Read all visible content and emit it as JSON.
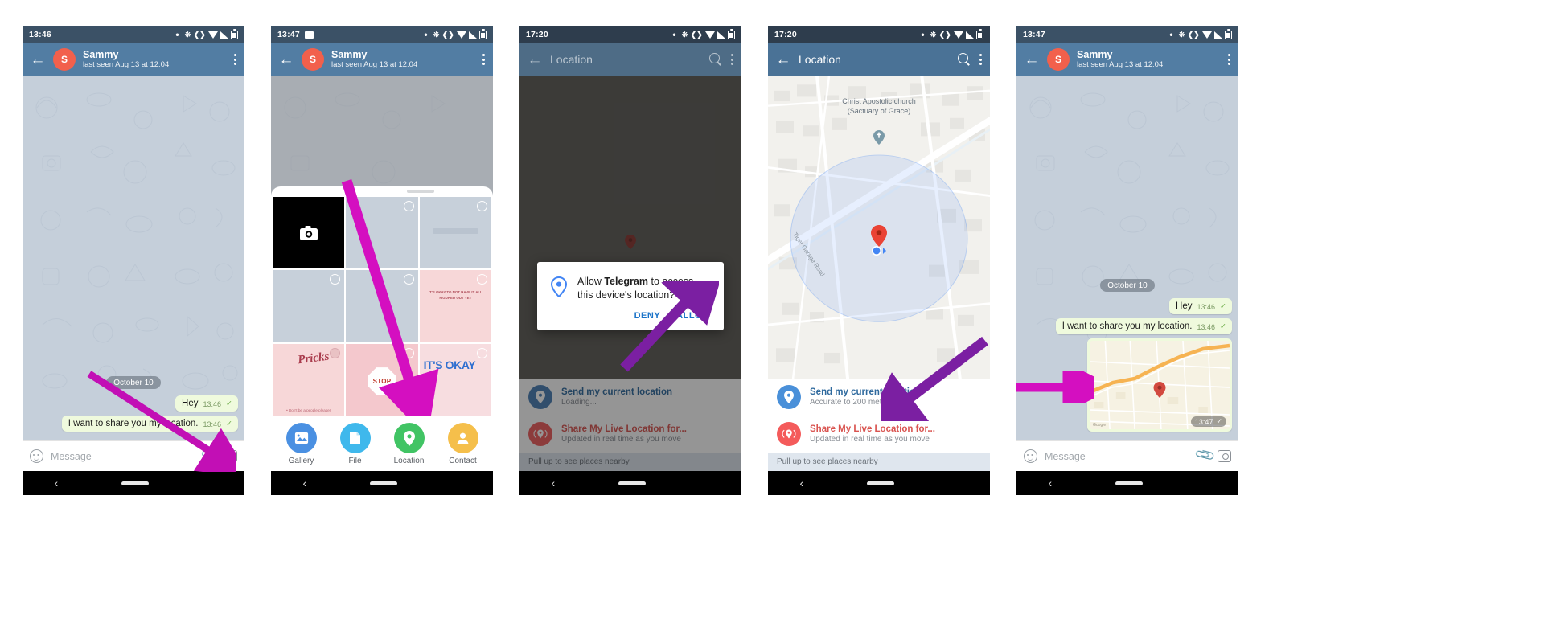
{
  "panels": [
    {
      "id": "chat-before",
      "status": {
        "time": "13:46"
      },
      "appbar": {
        "name": "Sammy",
        "subtitle": "last seen Aug 13 at 12:04",
        "avatar_initial": "S"
      },
      "chat": {
        "date_chip": "October 10",
        "messages": [
          {
            "text": "Hey",
            "time": "13:46",
            "status": "✓"
          },
          {
            "text": "I want to share you my location.",
            "time": "13:46",
            "status": "✓"
          }
        ]
      },
      "composer": {
        "placeholder": "Message"
      }
    },
    {
      "id": "attach-sheet",
      "status": {
        "time": "13:47"
      },
      "appbar": {
        "name": "Sammy",
        "subtitle": "last seen Aug 13 at 12:04",
        "avatar_initial": "S"
      },
      "attach_options": [
        {
          "label": "Gallery",
          "color": "#4a90e2",
          "icon": "image-icon"
        },
        {
          "label": "File",
          "color": "#3fb8ec",
          "icon": "file-icon"
        },
        {
          "label": "Location",
          "color": "#41c464",
          "icon": "pin-icon"
        },
        {
          "label": "Contact",
          "color": "#f5bf4b",
          "icon": "person-icon"
        }
      ],
      "gallery_tiles": [
        {
          "kind": "camera",
          "label": ""
        },
        {
          "kind": "photo",
          "label": ""
        },
        {
          "kind": "photo",
          "label": ""
        },
        {
          "kind": "photo",
          "label": ""
        },
        {
          "kind": "photo",
          "label": ""
        },
        {
          "kind": "note",
          "label": "IT'S OKAY TO NOT HAVE IT ALL FIGURED OUT YET"
        },
        {
          "kind": "pricks",
          "label": "Pricks"
        },
        {
          "kind": "stop",
          "label": "STOP"
        },
        {
          "kind": "okay",
          "label": "IT'S OKAY"
        }
      ]
    },
    {
      "id": "permission-dialog",
      "status": {
        "time": "17:20"
      },
      "appbar": {
        "title": "Location"
      },
      "dialog": {
        "text_before": "Allow ",
        "app_name": "Telegram",
        "text_after": " to access this device's location?",
        "deny_label": "DENY",
        "allow_label": "ALLOW"
      },
      "location_list": [
        {
          "title": "Send my current location",
          "subtitle": "Loading...",
          "color": "#4a7fb5",
          "icon": "pin-icon"
        },
        {
          "title": "Share My Live Location for...",
          "subtitle": "Updated in real time as you move",
          "color": "#ef5b5b",
          "icon": "live-pin-icon"
        }
      ],
      "footer": "Pull up to see places nearby"
    },
    {
      "id": "location-picker",
      "status": {
        "time": "17:20"
      },
      "appbar": {
        "title": "Location"
      },
      "map": {
        "poi_label_line1": "Christ Apostolic church",
        "poi_label_line2": "(Sactuary of Grace)",
        "street_label": "Tiger Garage Road"
      },
      "location_list": [
        {
          "title": "Send my current location",
          "subtitle": "Accurate to 200 meters",
          "color": "#4a90d9",
          "icon": "pin-icon"
        },
        {
          "title": "Share My Live Location for...",
          "subtitle": "Updated in real time as you move",
          "color": "#f45b5b",
          "icon": "live-pin-icon"
        }
      ],
      "footer": "Pull up to see places nearby"
    },
    {
      "id": "chat-after",
      "status": {
        "time": "13:47"
      },
      "appbar": {
        "name": "Sammy",
        "subtitle": "last seen Aug 13 at 12:04",
        "avatar_initial": "S"
      },
      "chat": {
        "date_chip": "October 10",
        "messages": [
          {
            "text": "Hey",
            "time": "13:46",
            "status": "✓"
          },
          {
            "text": "I want to share you my location.",
            "time": "13:46",
            "status": "✓"
          }
        ],
        "map_message": {
          "time": "13:47",
          "status": "✓"
        }
      },
      "composer": {
        "placeholder": "Message"
      }
    }
  ],
  "colors": {
    "appbar": "#527da3",
    "statusbar": "#3b5166",
    "chat_bg": "#c5cfda",
    "bubble_out": "#effadd",
    "accent_blue": "#1a73c8",
    "arrow_magenta": "#c20fb5",
    "arrow_purple": "#7b1fa2"
  }
}
